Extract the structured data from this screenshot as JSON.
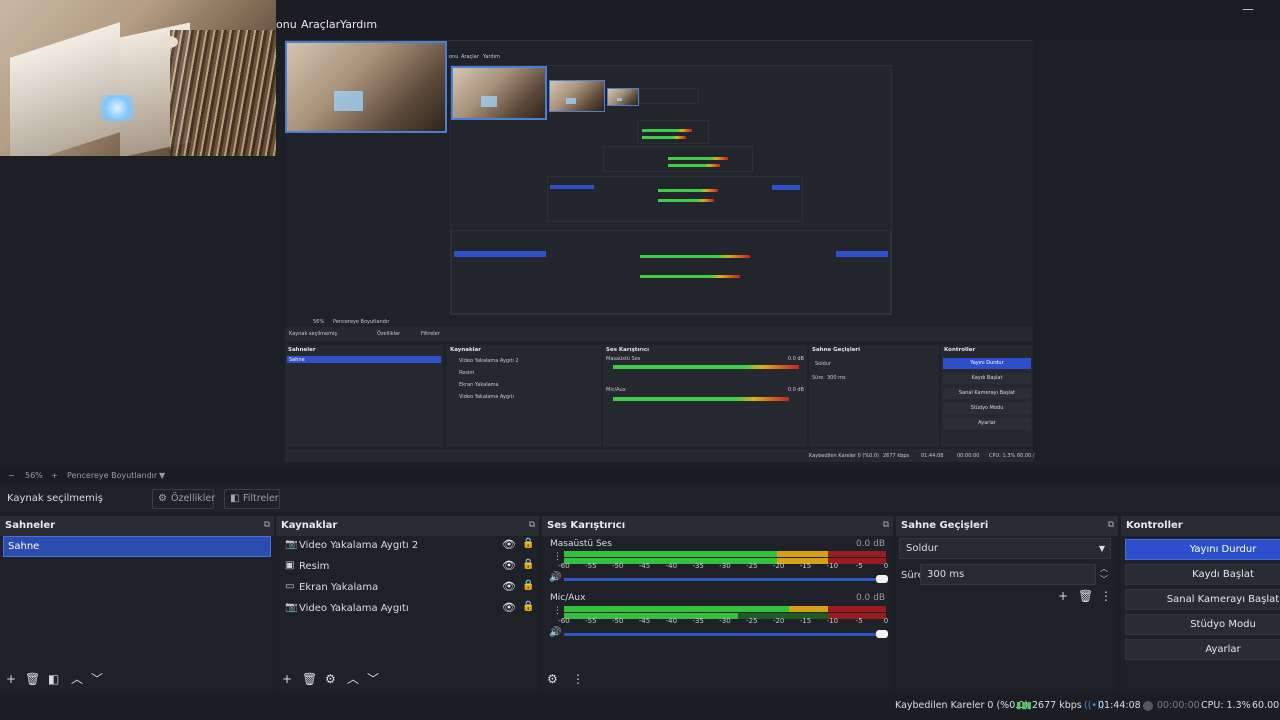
{
  "menu": {
    "items": [
      "onu",
      "Araçlar",
      "Yardım"
    ]
  },
  "zoom": {
    "minus": "−",
    "percent": "56%",
    "plus": "+",
    "fit_label": "Pencereye Boyutlandır",
    "dropdown": "▼"
  },
  "context": {
    "label": "Kaynak seçilmemiş",
    "properties_label": "Özellikler",
    "filters_label": "Filtreler"
  },
  "scenes": {
    "title": "Sahneler",
    "items": [
      "Sahne"
    ]
  },
  "sources": {
    "title": "Kaynaklar",
    "items": [
      {
        "label": "Video Yakalama Aygıtı 2",
        "icon": "camera-icon"
      },
      {
        "label": "Resim",
        "icon": "image-icon"
      },
      {
        "label": "Ekran Yakalama",
        "icon": "monitor-icon"
      },
      {
        "label": "Video Yakalama Aygıtı",
        "icon": "camera-icon"
      }
    ]
  },
  "mixer": {
    "title": "Ses Karıştırıcı",
    "channels": [
      {
        "name": "Masaüstü Ses",
        "db": "0.0 dB",
        "level": 0.82
      },
      {
        "name": "Mic/Aux",
        "db": "0.0 dB",
        "level": 0.72
      }
    ],
    "ticks": [
      "-60",
      "-55",
      "-50",
      "-45",
      "-40",
      "-35",
      "-30",
      "-25",
      "-20",
      "-15",
      "-10",
      "-5",
      "0"
    ]
  },
  "transitions": {
    "title": "Sahne Geçişleri",
    "selected": "Soldur",
    "duration_label": "Süre",
    "duration_value": "300 ms"
  },
  "controls": {
    "title": "Kontroller",
    "buttons": [
      "Yayını Durdur",
      "Kaydı Başlat",
      "Sanal Kamerayı Başlat",
      "Stüdyo Modu",
      "Ayarlar"
    ]
  },
  "status": {
    "dropped": "Kaybedilen Kareler 0 (%0.0)",
    "bitrate": "2677 kbps",
    "stream_time": "01:44:08",
    "rec_time": "00:00:00",
    "cpu": "CPU: 1.3%",
    "fps": "60.00 /"
  },
  "mini": {
    "menu": [
      "onu",
      "Araçlar",
      "Yardım"
    ],
    "context": "Kaynak seçilmemiş",
    "props": "Özellikler",
    "filters": "Filtreler",
    "zoom": "56%",
    "fit": "Pencereye Boyutlandır",
    "scenes_title": "Sahneler",
    "scene": "Sahne",
    "sources_title": "Kaynaklar",
    "sources": [
      "Video Yakalama Aygıtı 2",
      "Resim",
      "Ekran Yakalama",
      "Video Yakalama Aygıtı"
    ],
    "mixer_title": "Ses Karıştırıcı",
    "desktop": "Masaüstü Ses",
    "mic": "Mic/Aux",
    "db": "0.0 dB",
    "trans_title": "Sahne Geçişleri",
    "trans": "Soldur",
    "dur_label": "Süre",
    "dur": "300 ms",
    "ctrl_title": "Kontroller",
    "ctrl": [
      "Yayını Durdur",
      "Kaydı Başlat",
      "Sanal Kamerayı Başlat",
      "Stüdyo Modu",
      "Ayarlar"
    ],
    "status": "Kaybedilen Kareler 0 (%0.0)",
    "bitrate": "2677 kbps",
    "time": "01:44:08",
    "rec": "00:00:00",
    "cpu": "CPU: 1.3%",
    "fps": "60.00 /"
  },
  "colors": {
    "accent": "#2d4fcb",
    "meter_green": "#34c13b",
    "meter_yellow": "#d4a21a",
    "meter_red": "#9a1b22"
  }
}
